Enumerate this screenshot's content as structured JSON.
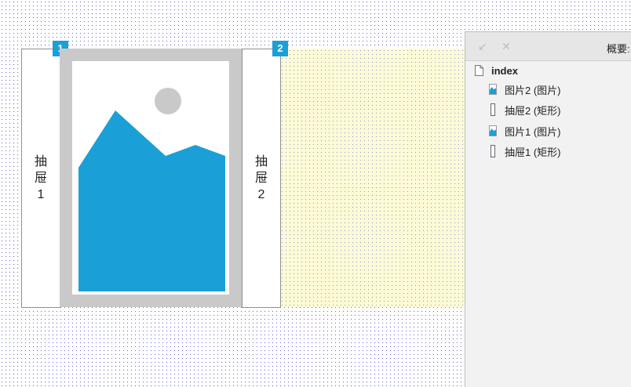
{
  "canvas": {
    "drawers": [
      {
        "label": "抽\n屉\n1",
        "badge": "1"
      },
      {
        "label": "抽\n屉\n2",
        "badge": "2"
      }
    ],
    "image_placeholder": {
      "icon": "image-placeholder-icon"
    }
  },
  "outline_panel": {
    "title": "概要:",
    "header_icons": [
      "collapse-icon",
      "close-icon"
    ],
    "root": {
      "label": "index",
      "icon": "page-icon"
    },
    "items": [
      {
        "label": "图片2 (图片)",
        "icon": "image-icon"
      },
      {
        "label": "抽屉2 (矩形)",
        "icon": "rectangle-icon"
      },
      {
        "label": "图片1 (图片)",
        "icon": "image-icon"
      },
      {
        "label": "抽屉1 (矩形)",
        "icon": "rectangle-icon"
      }
    ]
  },
  "colors": {
    "accent": "#1aa0d6",
    "frame": "#c9c9c9",
    "selection_area": "#fdfbd6"
  }
}
